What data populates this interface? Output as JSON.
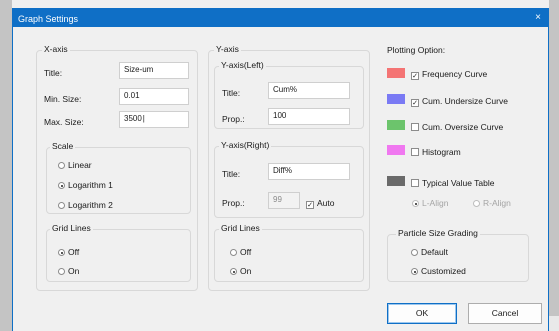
{
  "title": "Graph Settings",
  "close_glyph": "×",
  "xaxis": {
    "legend": "X-axis",
    "title_label": "Title:",
    "title_value": "Size-um",
    "min_label": "Min. Size:",
    "min_value": "0.01",
    "max_label": "Max. Size:",
    "max_value": "3500",
    "scale": {
      "legend": "Scale",
      "options": [
        "Linear",
        "Logarithm 1",
        "Logarithm 2"
      ],
      "selected": "Logarithm 1"
    },
    "grid": {
      "legend": "Grid Lines",
      "options": [
        "Off",
        "On"
      ],
      "selected": "Off"
    }
  },
  "yaxis": {
    "legend": "Y-axis",
    "left": {
      "legend": "Y-axis(Left)",
      "title_label": "Title:",
      "title_value": "Cum%",
      "prop_label": "Prop.:",
      "prop_value": "100"
    },
    "right": {
      "legend": "Y-axis(Right)",
      "title_label": "Title:",
      "title_value": "Diff%",
      "prop_label": "Prop.:",
      "prop_value": "99",
      "auto_label": "Auto",
      "auto_checked": true
    },
    "grid": {
      "legend": "Grid Lines",
      "options": [
        "Off",
        "On"
      ],
      "selected": "On"
    }
  },
  "plotting": {
    "legend": "Plotting Option:",
    "items": [
      {
        "label": "Frequency Curve",
        "color": "#f47474",
        "checked": true
      },
      {
        "label": "Cum. Undersize Curve",
        "color": "#7a7af4",
        "checked": true
      },
      {
        "label": "Cum. Oversize Curve",
        "color": "#6cc46c",
        "checked": false
      },
      {
        "label": "Histogram",
        "color": "#f078f0",
        "checked": false
      },
      {
        "label": "Typical Value Table",
        "color": "#6a6a6a",
        "checked": false
      }
    ],
    "align": {
      "options": [
        "L-Align",
        "R-Align"
      ],
      "selected": "L-Align"
    },
    "grading": {
      "legend": "Particle Size Grading",
      "options": [
        "Default",
        "Customized"
      ],
      "selected": "Customized"
    }
  },
  "buttons": {
    "ok": "OK",
    "cancel": "Cancel"
  },
  "check_glyph": "✓"
}
